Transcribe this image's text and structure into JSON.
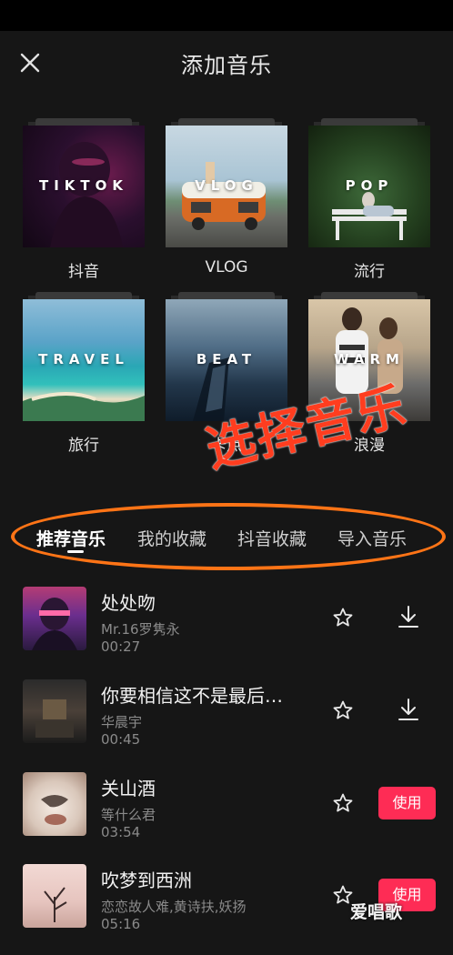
{
  "header": {
    "title": "添加音乐"
  },
  "categories": [
    {
      "name": "抖音",
      "cover_word": "TIKTOK"
    },
    {
      "name": "VLOG",
      "cover_word": "VLOG"
    },
    {
      "name": "流行",
      "cover_word": "POP"
    },
    {
      "name": "旅行",
      "cover_word": "TRAVEL"
    },
    {
      "name": "卡点",
      "cover_word": "BEAT"
    },
    {
      "name": "浪漫",
      "cover_word": "WARM"
    }
  ],
  "annotation": {
    "text": "选择音乐",
    "color": "#ff3d1f",
    "oval_color": "#ff7416"
  },
  "tabs": [
    {
      "label": "推荐音乐",
      "active": true
    },
    {
      "label": "我的收藏",
      "active": false
    },
    {
      "label": "抖音收藏",
      "active": false
    },
    {
      "label": "导入音乐",
      "active": false
    }
  ],
  "songs": [
    {
      "title": "处处吻",
      "artist": "Mr.16罗隽永",
      "duration": "00:27",
      "action": "download"
    },
    {
      "title": "你要相信这不是最后…",
      "artist": "华晨宇",
      "duration": "00:45",
      "action": "download"
    },
    {
      "title": "关山酒",
      "artist": "等什么君",
      "duration": "03:54",
      "action": "use",
      "use_label": "使用"
    },
    {
      "title": "吹梦到西洲",
      "artist": "恋恋故人难,黄诗扶,妖扬",
      "duration": "05:16",
      "action": "use",
      "use_label": "使用"
    }
  ],
  "watermark": "爱唱歌",
  "colors": {
    "background": "#161616",
    "accent": "#fe2c55"
  }
}
